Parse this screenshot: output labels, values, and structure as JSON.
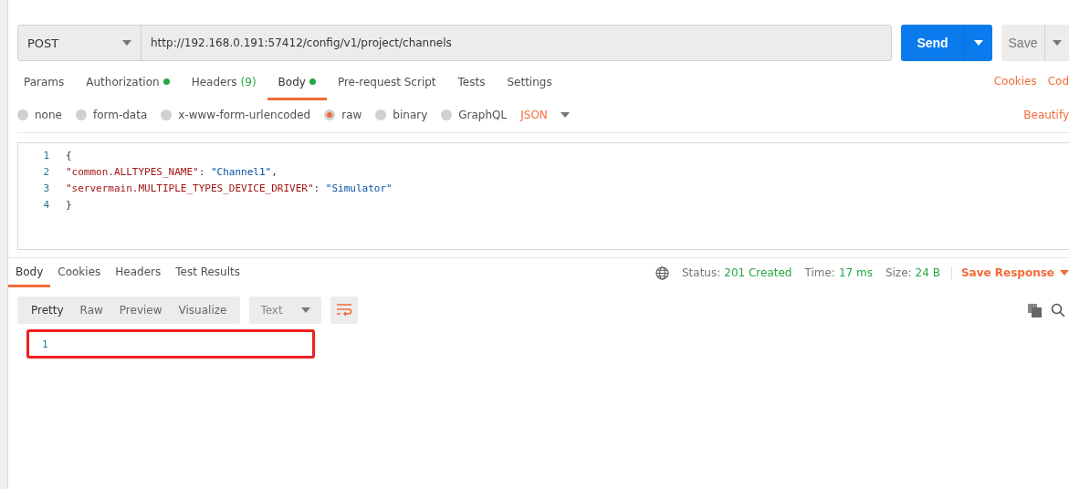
{
  "request": {
    "method": "POST",
    "url": "http://192.168.0.191:57412/config/v1/project/channels",
    "send": "Send",
    "save": "Save"
  },
  "tabs": [
    {
      "label": "Params",
      "selected": false,
      "indicator": false
    },
    {
      "label": "Authorization",
      "selected": false,
      "indicator": true
    },
    {
      "label": "Headers",
      "count": "(9)",
      "selected": false,
      "indicator": false
    },
    {
      "label": "Body",
      "selected": true,
      "indicator": true
    },
    {
      "label": "Pre-request Script",
      "selected": false,
      "indicator": false
    },
    {
      "label": "Tests",
      "selected": false,
      "indicator": false
    },
    {
      "label": "Settings",
      "selected": false,
      "indicator": false
    }
  ],
  "tab_links": [
    "Cookies",
    "Cod"
  ],
  "body_types": [
    {
      "label": "none",
      "selected": false
    },
    {
      "label": "form-data",
      "selected": false
    },
    {
      "label": "x-www-form-urlencoded",
      "selected": false
    },
    {
      "label": "raw",
      "selected": true
    },
    {
      "label": "binary",
      "selected": false
    },
    {
      "label": "GraphQL",
      "selected": false
    }
  ],
  "body_format": "JSON",
  "beautify": "Beautify",
  "editor": [
    {
      "number": "1",
      "parts": [
        {
          "kind": "punct",
          "text": "{"
        }
      ]
    },
    {
      "number": "2",
      "parts": [
        {
          "kind": "key",
          "text": "\"common.ALLTYPES_NAME\""
        },
        {
          "kind": "punct",
          "text": ": "
        },
        {
          "kind": "string",
          "text": "\"Channel1\""
        },
        {
          "kind": "punct",
          "text": ","
        }
      ]
    },
    {
      "number": "3",
      "parts": [
        {
          "kind": "key",
          "text": "\"servermain.MULTIPLE_TYPES_DEVICE_DRIVER\""
        },
        {
          "kind": "punct",
          "text": ": "
        },
        {
          "kind": "string",
          "text": "\"Simulator\""
        }
      ]
    },
    {
      "number": "4",
      "parts": [
        {
          "kind": "punct",
          "text": "}"
        }
      ]
    }
  ],
  "response": {
    "tabs": [
      {
        "label": "Body",
        "selected": true
      },
      {
        "label": "Cookies",
        "selected": false
      },
      {
        "label": "Headers",
        "selected": false
      },
      {
        "label": "Test Results",
        "selected": false
      }
    ],
    "stats": [
      {
        "label": "Status:",
        "value": "201 Created"
      },
      {
        "label": "Time:",
        "value": "17 ms"
      },
      {
        "label": "Size:",
        "value": "24 B"
      }
    ],
    "save": "Save Response",
    "views": [
      {
        "label": "Pretty",
        "selected": true
      },
      {
        "label": "Raw",
        "selected": false
      },
      {
        "label": "Preview",
        "selected": false
      },
      {
        "label": "Visualize",
        "selected": false
      }
    ],
    "format": "Text",
    "lines": [
      {
        "number": "1"
      }
    ],
    "highlighted": true
  }
}
